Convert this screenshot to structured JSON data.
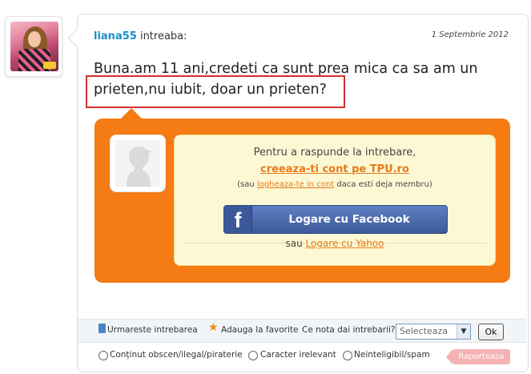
{
  "question": {
    "username": "liana55",
    "verb": "intreaba:",
    "date": "1 Septembrie 2012",
    "text": "Buna.am 11 ani,credeti ca sunt prea mica ca sa am un prieten,nu iubit, doar un prieten?"
  },
  "answer_panel": {
    "title": "Pentru a raspunde la intrebare,",
    "create_account": "creeaza-ti cont pe TPU.ro",
    "sub_prefix": "(sau ",
    "sub_link": "logheaza-te in cont",
    "sub_suffix": " daca esti deja membru)",
    "facebook_logo": "f",
    "facebook_button": "Logare cu Facebook",
    "yahoo_prefix": "sau ",
    "yahoo_link": "Logare cu Yahoo"
  },
  "toolbar": {
    "follow": "Urmareste intrebarea",
    "favorite": "Adauga la favorite",
    "rate_label": "Ce nota dai intrebarii?",
    "rate_select": "Selecteaza",
    "ok": "Ok"
  },
  "report": {
    "options": [
      "Conținut obscen/ilegal/piraterie",
      "Caracter irelevant",
      "Neinteligibil/spam"
    ],
    "button": "Raporteaza"
  },
  "colors": {
    "accent_orange": "#f57b14",
    "username_blue": "#1a8fc9",
    "facebook_blue": "#3b5998",
    "highlight_red": "#d32f2f"
  }
}
